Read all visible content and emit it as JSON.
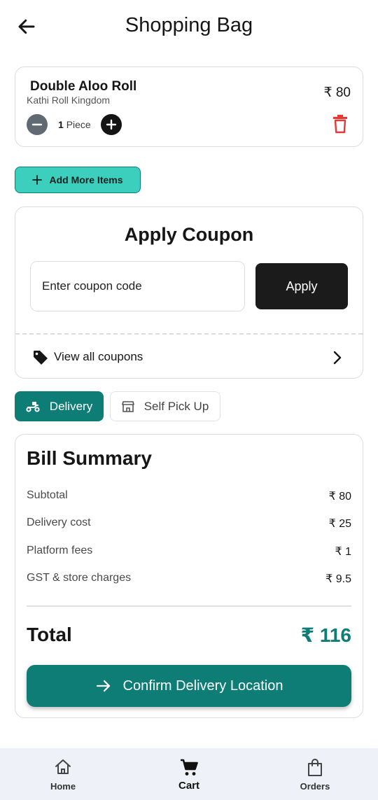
{
  "header": {
    "title": "Shopping Bag"
  },
  "cart_item": {
    "name": "Double Aloo Roll",
    "shop": "Kathi Roll Kingdom",
    "price": "₹ 80",
    "quantity": "1",
    "unit": "Piece"
  },
  "add_more": {
    "label": "Add More Items"
  },
  "coupon": {
    "title": "Apply Coupon",
    "placeholder": "Enter coupon code",
    "apply_label": "Apply",
    "view_all_label": "View all coupons"
  },
  "fulfillment": {
    "selected": "Delivery",
    "delivery_label": "Delivery",
    "pickup_label": "Self Pick Up"
  },
  "bill": {
    "title": "Bill Summary",
    "rows": [
      {
        "label": "Subtotal",
        "value": "₹ 80"
      },
      {
        "label": "Delivery cost",
        "value": "₹ 25"
      },
      {
        "label": "Platform fees",
        "value": "₹ 1"
      },
      {
        "label": "GST & store charges",
        "value": "₹ 9.5"
      }
    ],
    "total_label": "Total",
    "total_value": "₹ 116",
    "confirm_label": "Confirm Delivery Location"
  },
  "nav": {
    "items": [
      {
        "label": "Home",
        "icon": "home-icon",
        "active": false
      },
      {
        "label": "Cart",
        "icon": "cart-icon",
        "active": true
      },
      {
        "label": "Orders",
        "icon": "shopping-bag-icon",
        "active": false
      }
    ]
  },
  "colors": {
    "accent": "#0e7d75",
    "add_more_bg": "#3ccfbd",
    "delete_red": "#e53935",
    "dark_button": "#1b1b1b",
    "nav_bg": "#eef1f7"
  }
}
